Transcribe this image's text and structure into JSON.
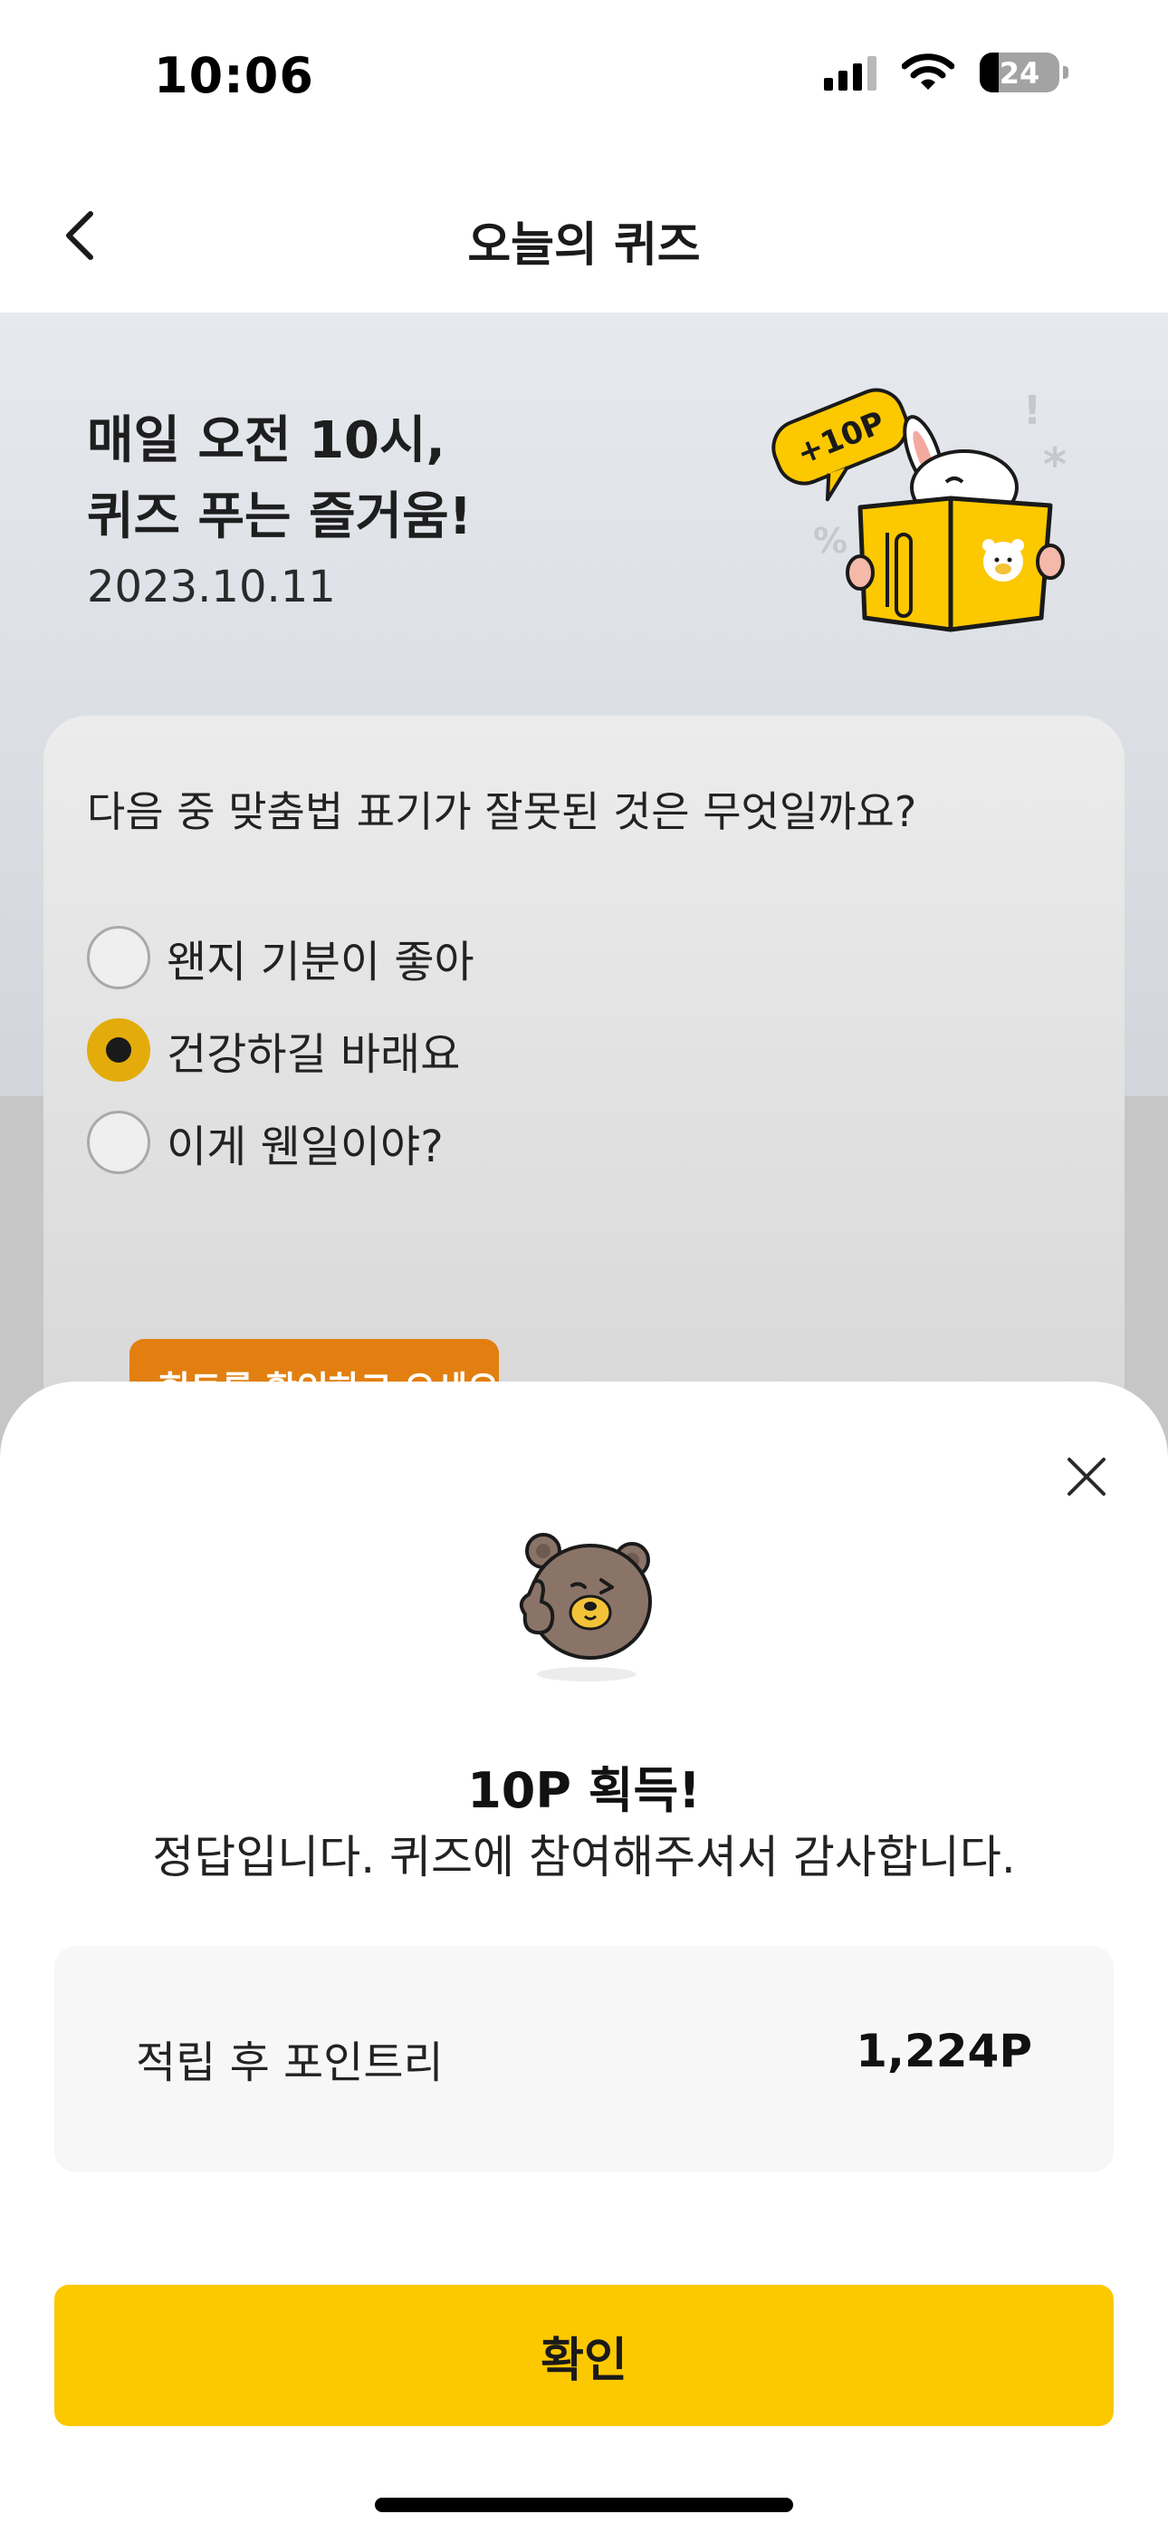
{
  "status_bar": {
    "time": "10:06",
    "battery_level": "24",
    "icons": [
      "signal-icon",
      "wifi-icon",
      "battery-icon"
    ]
  },
  "nav": {
    "title": "오늘의 퀴즈",
    "back_icon": "chevron-left-icon"
  },
  "quiz": {
    "headline_line1": "매일 오전 10시,",
    "headline_line2": "퀴즈 푸는 즐거움!",
    "date": "2023.10.11",
    "badge": "+10P",
    "question": "다음 중 맞춤법 표기가 잘못된 것은 무엇일까요?",
    "options": [
      {
        "label": "왠지 기분이 좋아",
        "selected": false
      },
      {
        "label": "건강하길 바래요",
        "selected": true
      },
      {
        "label": "이게 웬일이야?",
        "selected": false
      }
    ],
    "hint_button": "힌트를 확인하고 오세요!"
  },
  "result_sheet": {
    "title": "10P 획득!",
    "message": "정답입니다. 퀴즈에 참여해주셔서 감사합니다.",
    "points_label": "적립 후 포인트리",
    "points_value": "1,224P",
    "confirm_label": "확인",
    "close_icon": "close-icon",
    "mascot_icon": "bear-thumbs-up-icon"
  },
  "colors": {
    "accent_yellow": "#FCC800",
    "radio_selected": "#E3AC0B",
    "hint_orange": "#E27F10"
  }
}
